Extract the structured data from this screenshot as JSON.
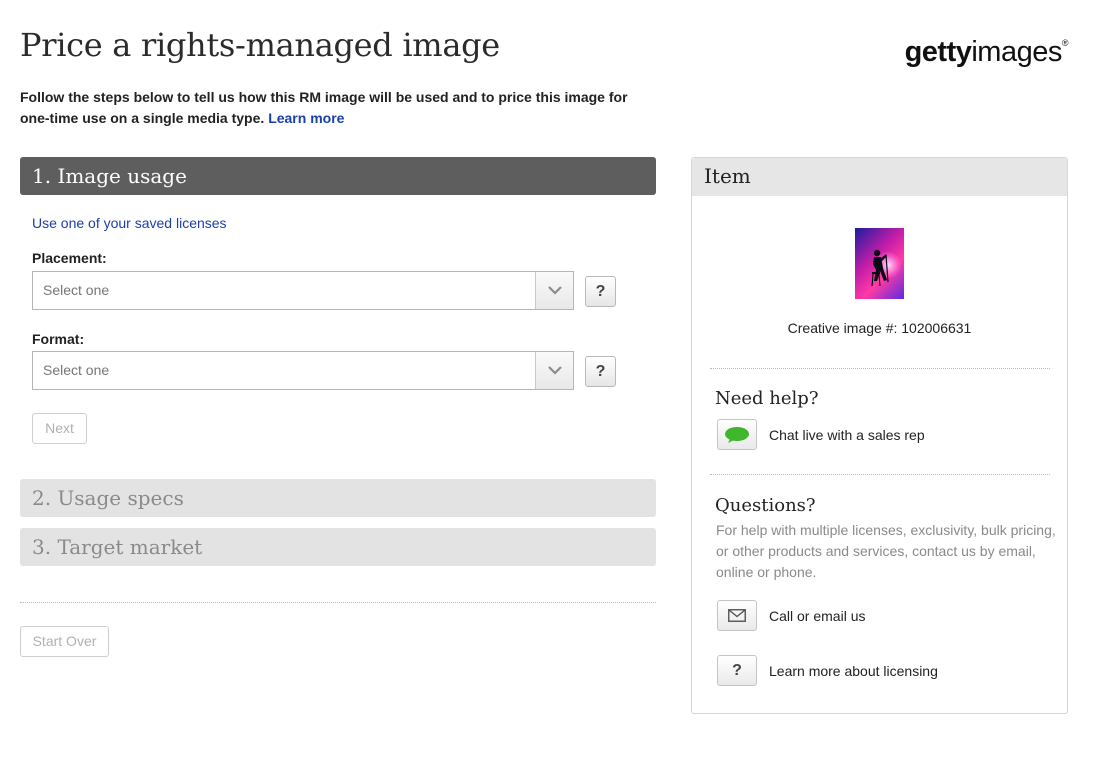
{
  "header": {
    "title": "Price a rights-managed image",
    "logo_bold": "getty",
    "logo_light": "images",
    "logo_mark": "®"
  },
  "intro": {
    "text": "Follow the steps below to tell us how this RM image will be used and to price this image for one-time use on a single media type.",
    "learn_more": "Learn more"
  },
  "steps": [
    {
      "label": "1. Image usage",
      "active": true
    },
    {
      "label": "2. Usage specs",
      "active": false
    },
    {
      "label": "3. Target market",
      "active": false
    }
  ],
  "usage": {
    "saved_licenses_link": "Use one of your saved licenses",
    "placement_label": "Placement:",
    "placement_value": "Select one",
    "format_label": "Format:",
    "format_value": "Select one",
    "help_glyph": "?",
    "next_label": "Next",
    "start_over_label": "Start Over"
  },
  "item_panel": {
    "title": "Item",
    "caption": "Creative image #: 102006631",
    "need_help_title": "Need help?",
    "chat_label": "Chat live with a sales rep",
    "questions_title": "Questions?",
    "questions_text": "For help with multiple licenses, exclusivity, bulk pricing, or other products and services, contact us by email, online or phone.",
    "call_label": "Call or email us",
    "licensing_label": "Learn more about licensing",
    "licensing_glyph": "?"
  },
  "icons": {
    "chevron": "chevron-down-icon",
    "chat": "chat-bubble-icon",
    "mail": "envelope-icon",
    "help": "question-mark-icon"
  },
  "colors": {
    "link": "#1a3fa8",
    "active_step": "#5e5e5e",
    "inactive_step": "#e3e3e3",
    "chat_green": "#3fb62c"
  }
}
